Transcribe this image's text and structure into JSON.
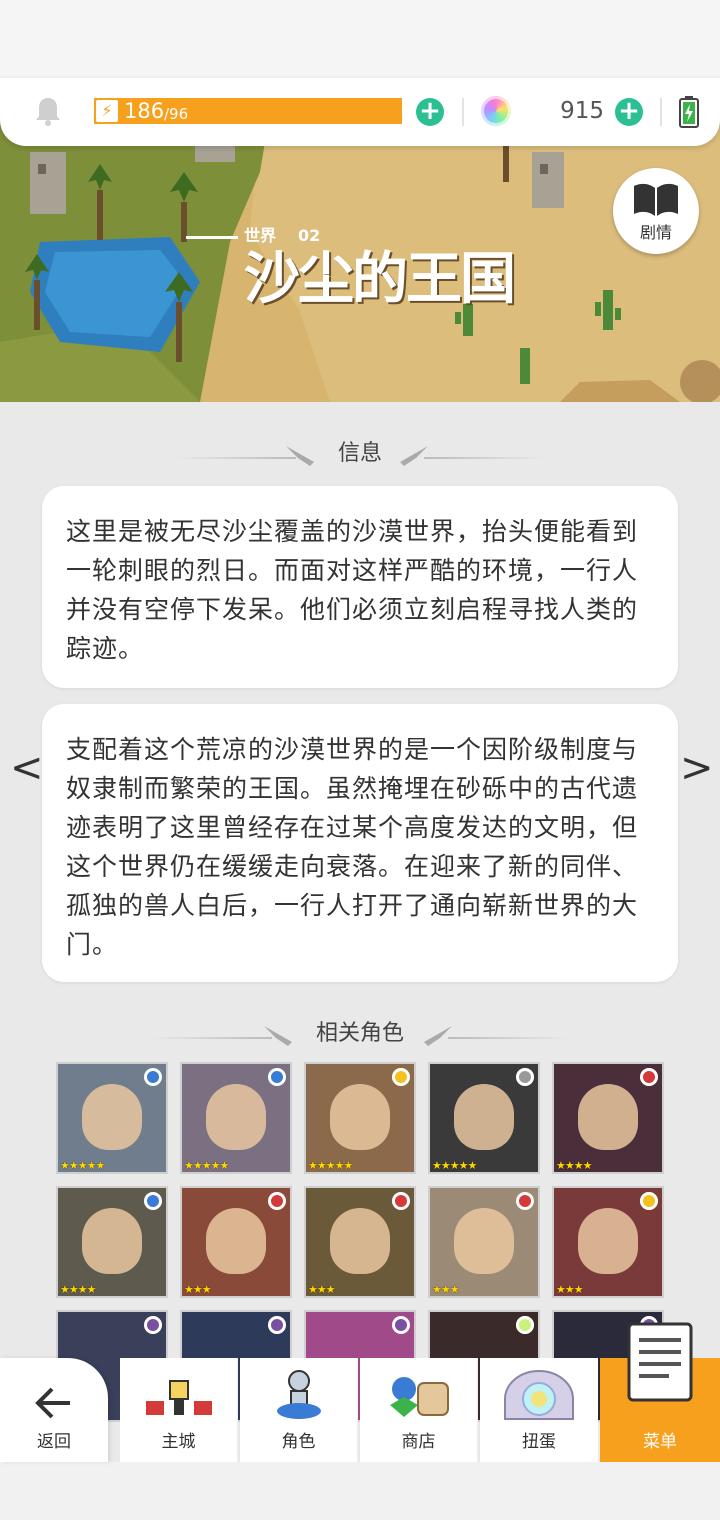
{
  "topbar": {
    "energy_current": "186",
    "energy_max": "/96",
    "gems": "915"
  },
  "banner": {
    "world_label": "世界",
    "world_number": "02",
    "title": "沙尘的王国",
    "story_label": "剧情"
  },
  "info": {
    "header": "信息",
    "para1": "这里是被无尽沙尘覆盖的沙漠世界，抬头便能看到一轮刺眼的烈日。而面对这样严酷的环境，一行人并没有空停下发呆。他们必须立刻启程寻找人类的踪迹。",
    "para2": "支配着这个荒凉的沙漠世界的是一个因阶级制度与奴隶制而繁荣的王国。虽然掩埋在砂砾中的古代遗迹表明了这里曾经存在过某个高度发达的文明，但这个世界仍在缓缓走向衰落。在迎来了新的同伴、孤独的兽人白后，一行人打开了通向崭新世界的大门。",
    "prev": "<",
    "next": ">"
  },
  "related": {
    "header": "相关角色",
    "characters": [
      {
        "stars": "★★★★★",
        "element": "blue"
      },
      {
        "stars": "★★★★★",
        "element": "blue"
      },
      {
        "stars": "★★★★★",
        "element": "yellow"
      },
      {
        "stars": "★★★★★",
        "element": "gray"
      },
      {
        "stars": "★★★★",
        "element": "red"
      },
      {
        "stars": "★★★★",
        "element": "blue"
      },
      {
        "stars": "★★★",
        "element": "red"
      },
      {
        "stars": "★★★",
        "element": "red"
      },
      {
        "stars": "★★★",
        "element": "red"
      },
      {
        "stars": "★★★",
        "element": "yellow"
      }
    ]
  },
  "nav": {
    "back": "返回",
    "home": "主城",
    "hero": "角色",
    "shop": "商店",
    "gacha": "扭蛋",
    "menu": "菜单"
  },
  "colors": {
    "accent": "#f7a01e",
    "plus": "#2bbf93",
    "text": "#333333"
  }
}
